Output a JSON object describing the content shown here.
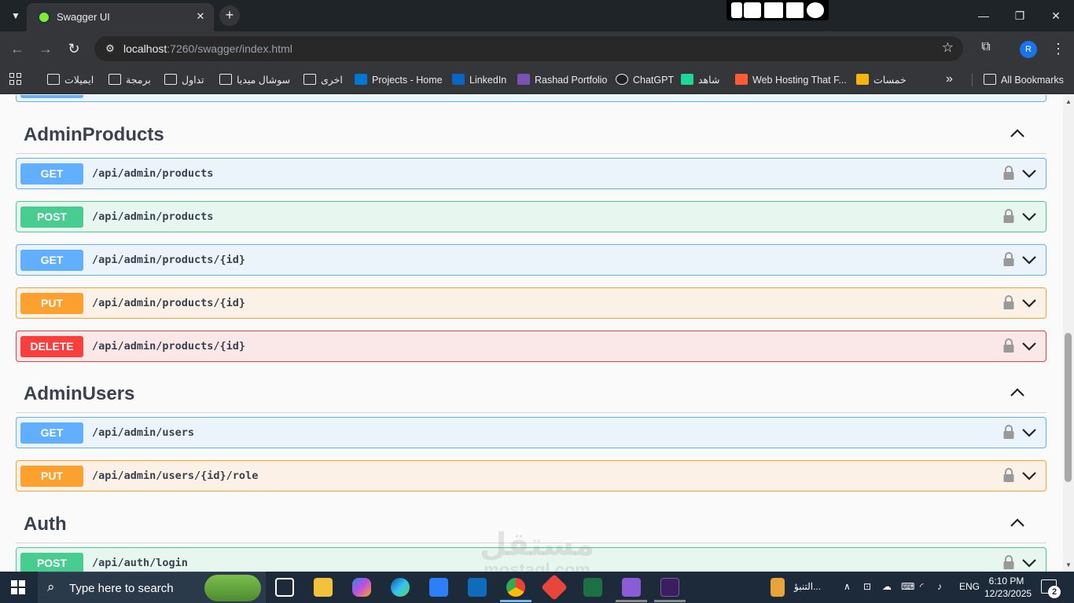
{
  "browser": {
    "tab_title": "Swagger UI",
    "url_host": "localhost",
    "url_rest": ":7260/swagger/index.html",
    "profile_initial": "R",
    "bookmarks": [
      {
        "label": "ايميلات",
        "icon": "folder-icon"
      },
      {
        "label": "برمجة",
        "icon": "folder-icon"
      },
      {
        "label": "تداول",
        "icon": "folder-icon"
      },
      {
        "label": "سوشال ميديا",
        "icon": "folder-icon"
      },
      {
        "label": "اخرى",
        "icon": "folder-icon"
      },
      {
        "label": "Projects - Home",
        "icon": "azure-devops-icon"
      },
      {
        "label": "LinkedIn",
        "icon": "linkedin-icon"
      },
      {
        "label": "Rashad Portfolio",
        "icon": "bootstrap-icon"
      },
      {
        "label": "ChatGPT",
        "icon": "chatgpt-icon"
      },
      {
        "label": "شاهد",
        "icon": "shahid-icon"
      },
      {
        "label": "Web Hosting That F...",
        "icon": "hosting-icon"
      },
      {
        "label": "خمسات",
        "icon": "khamsat-icon"
      }
    ],
    "all_bookmarks_label": "All Bookmarks"
  },
  "sections": [
    {
      "title": "AdminProducts",
      "operations": [
        {
          "method": "GET",
          "path": "/api/admin/products"
        },
        {
          "method": "POST",
          "path": "/api/admin/products"
        },
        {
          "method": "GET",
          "path": "/api/admin/products/{id}"
        },
        {
          "method": "PUT",
          "path": "/api/admin/products/{id}"
        },
        {
          "method": "DELETE",
          "path": "/api/admin/products/{id}"
        }
      ]
    },
    {
      "title": "AdminUsers",
      "operations": [
        {
          "method": "GET",
          "path": "/api/admin/users"
        },
        {
          "method": "PUT",
          "path": "/api/admin/users/{id}/role"
        }
      ]
    },
    {
      "title": "Auth",
      "operations": [
        {
          "method": "POST",
          "path": "/api/auth/login"
        }
      ]
    }
  ],
  "watermark": {
    "arabic": "مستقل",
    "latin": "mostaql.com"
  },
  "taskbar": {
    "search_placeholder": "Type here to search",
    "tray_app_label": "التنبؤ...",
    "language": "ENG",
    "time": "6:10 PM",
    "date": "12/23/2025",
    "notification_count": "2"
  },
  "colors": {
    "get": "#61affe",
    "post": "#49cc90",
    "put": "#fca130",
    "delete": "#f93e3e",
    "title_text": "#3b4151"
  }
}
